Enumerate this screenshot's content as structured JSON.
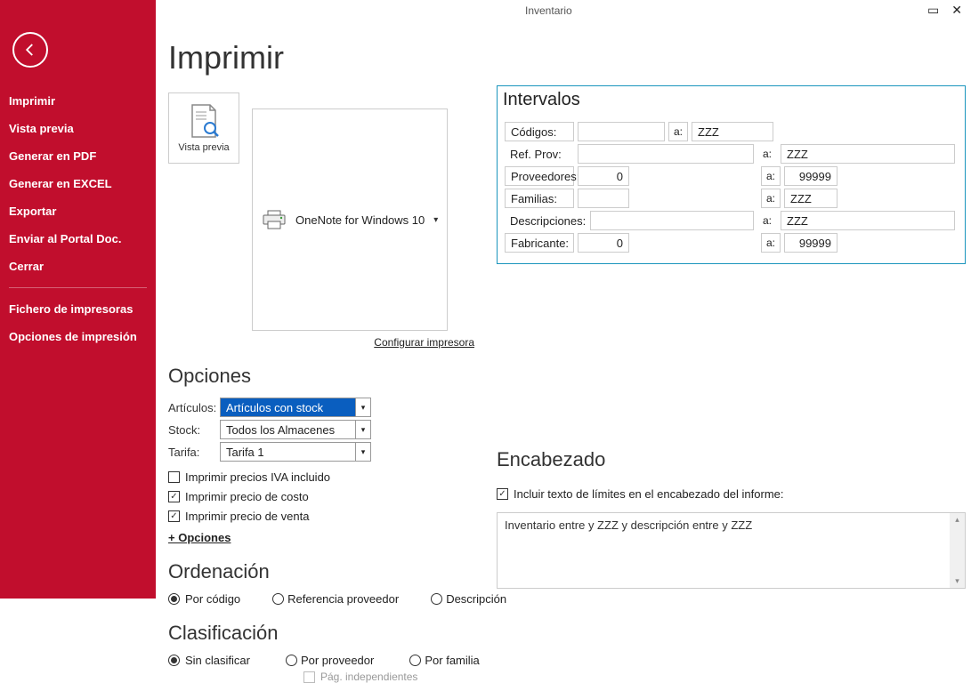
{
  "window": {
    "title": "Inventario"
  },
  "sidebar": {
    "items": [
      "Imprimir",
      "Vista previa",
      "Generar en PDF",
      "Generar en EXCEL",
      "Exportar",
      "Enviar al Portal Doc.",
      "Cerrar"
    ],
    "footer": [
      "Fichero de impresoras",
      "Opciones de impresión"
    ]
  },
  "page": {
    "title": "Imprimir"
  },
  "preview_button": "Vista previa",
  "printer": {
    "name": "OneNote for Windows 10",
    "config_link": "Configurar impresora"
  },
  "opciones": {
    "heading": "Opciones",
    "rows": {
      "articulos_lbl": "Artículos:",
      "articulos_val": "Artículos con stock",
      "stock_lbl": "Stock:",
      "stock_val": "Todos los Almacenes",
      "tarifa_lbl": "Tarifa:",
      "tarifa_val": "Tarifa 1"
    },
    "checks": {
      "iva": "Imprimir precios IVA incluido",
      "costo": "Imprimir precio de costo",
      "venta": "Imprimir precio de venta"
    },
    "more": "+ Opciones"
  },
  "ordenacion": {
    "heading": "Ordenación",
    "options": [
      "Por código",
      "Referencia proveedor",
      "Descripción"
    ]
  },
  "clasificacion": {
    "heading": "Clasificación",
    "options": [
      "Sin clasificar",
      "Por proveedor",
      "Por familia"
    ],
    "sub": "Pág. independientes"
  },
  "intervalos": {
    "heading": "Intervalos",
    "a": "a:",
    "rows": {
      "codigos_lbl": "Códigos:",
      "codigos_from": "",
      "codigos_to": "ZZZ",
      "refprov_lbl": "Ref. Prov:",
      "refprov_from": "",
      "refprov_to": "ZZZ",
      "prov_lbl": "Proveedores:",
      "prov_from": "0",
      "prov_to": "99999",
      "fam_lbl": "Familias:",
      "fam_from": "",
      "fam_to": "ZZZ",
      "desc_lbl": "Descripciones:",
      "desc_from": "",
      "desc_to": "ZZZ",
      "fab_lbl": "Fabricante:",
      "fab_from": "0",
      "fab_to": "99999"
    }
  },
  "encabezado": {
    "heading": "Encabezado",
    "check": "Incluir texto de límites en el encabezado del informe:",
    "text": "Inventario entre  y ZZZ y descripción entre  y ZZZ"
  }
}
